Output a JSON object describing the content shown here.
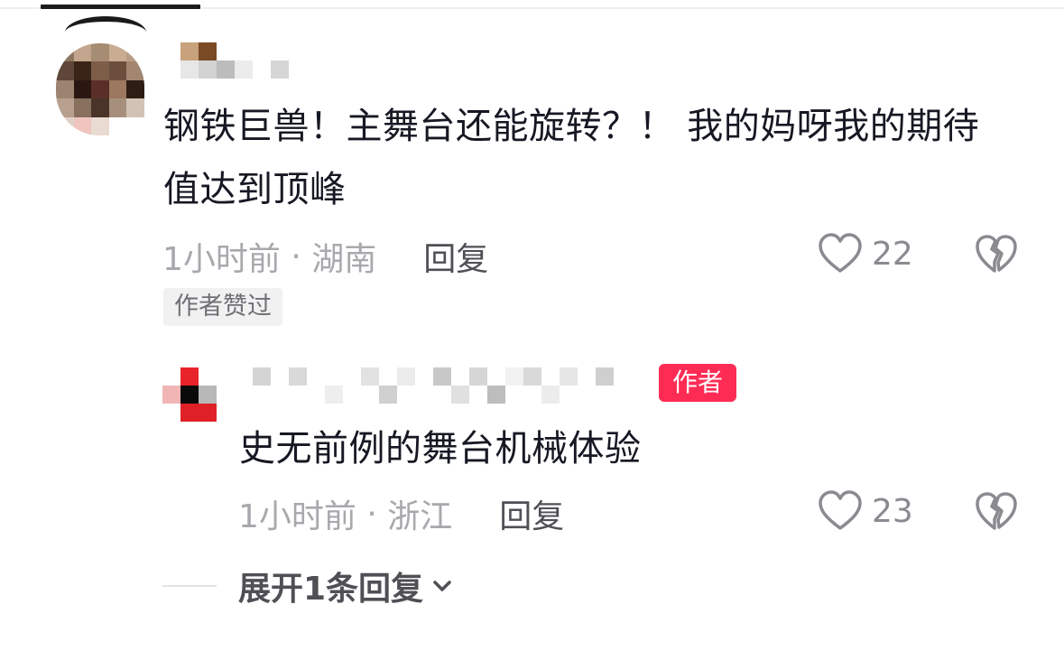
{
  "comment": {
    "text": "钢铁巨兽！主舞台还能旋转？！ 我的妈呀我的期待值达到顶峰",
    "time": "1小时前",
    "location": "湖南",
    "reply_label": "回复",
    "likes": "22",
    "author_liked_badge": "作者赞过"
  },
  "reply": {
    "author_badge": "作者",
    "text": "史无前例的舞台机械体验",
    "time": "1小时前",
    "location": "浙江",
    "reply_label": "回复",
    "likes": "23"
  },
  "expand": {
    "label": "展开1条回复"
  },
  "icons": {
    "like": "heart-outline-icon",
    "dislike": "broken-heart-icon",
    "expand": "chevron-down-icon"
  },
  "colors": {
    "accent": "#fe2c55",
    "text_primary": "#161823",
    "text_secondary": "#a8a8ad"
  }
}
